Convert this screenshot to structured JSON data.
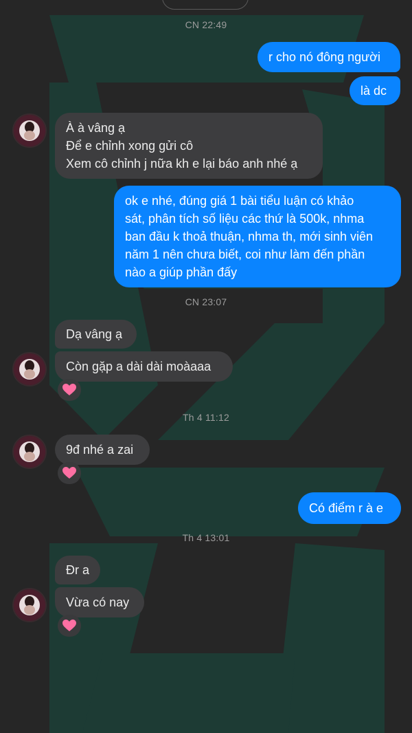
{
  "colors": {
    "background": "#262626",
    "outgoing_bubble": "#0a84ff",
    "incoming_bubble": "#3d3d3f",
    "timestamp": "#9c9c9c",
    "heart_reaction": "#ff6fa3"
  },
  "timestamps": [
    "CN 22:49",
    "CN 23:07",
    "Th 4 11:12",
    "Th 4 13:01"
  ],
  "messages": [
    {
      "from": "me",
      "lines": [
        "r cho nó đông người"
      ]
    },
    {
      "from": "me",
      "lines": [
        "là dc"
      ]
    },
    {
      "from": "contact",
      "lines": [
        "À à vâng ạ",
        "Để e chỉnh xong gửi cô",
        "Xem cô chỉnh j nữa kh e lại báo anh nhé ạ"
      ]
    },
    {
      "from": "me",
      "lines": [
        "ok e nhé, đúng giá 1 bài tiểu luận có khảo",
        "sát, phân tích số liệu các thứ là 500k, nhma",
        "ban đầu k thoả thuận, nhma th, mới sinh viên",
        "năm 1 nên chưa biết, coi như làm đến phần",
        "nào a giúp phần đấy"
      ]
    },
    {
      "from": "contact",
      "lines": [
        "Dạ vâng ạ"
      ]
    },
    {
      "from": "contact",
      "lines": [
        "Còn gặp a dài dài moàaaa"
      ],
      "reaction": "heart-icon"
    },
    {
      "from": "contact",
      "lines": [
        "9đ nhé a zai"
      ],
      "reaction": "heart-icon"
    },
    {
      "from": "me",
      "lines": [
        "Có điểm r à e"
      ]
    },
    {
      "from": "contact",
      "lines": [
        "Đr a"
      ]
    },
    {
      "from": "contact",
      "lines": [
        "Vừa có nay"
      ],
      "reaction": "heart-icon"
    }
  ]
}
